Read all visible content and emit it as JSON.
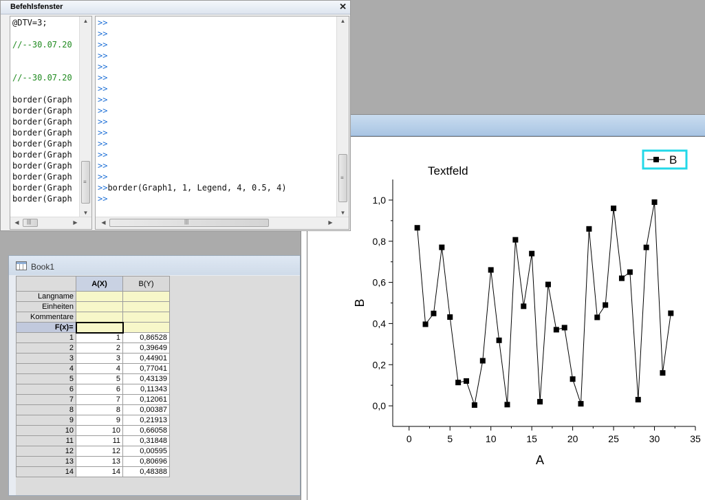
{
  "command_window": {
    "title": "Befehlsfenster",
    "close_glyph": "✕",
    "history_lines": [
      {
        "text": "@DTV=3;",
        "kind": "code"
      },
      {
        "text": "",
        "kind": "code"
      },
      {
        "text": "//--30.07.20",
        "kind": "comment"
      },
      {
        "text": "",
        "kind": "code"
      },
      {
        "text": "",
        "kind": "code"
      },
      {
        "text": "//--30.07.20",
        "kind": "comment"
      },
      {
        "text": "",
        "kind": "code"
      },
      {
        "text": "border(Graph",
        "kind": "code"
      },
      {
        "text": "border(Graph",
        "kind": "code"
      },
      {
        "text": "border(Graph",
        "kind": "code"
      },
      {
        "text": "border(Graph",
        "kind": "code"
      },
      {
        "text": "border(Graph",
        "kind": "code"
      },
      {
        "text": "border(Graph",
        "kind": "code"
      },
      {
        "text": "border(Graph",
        "kind": "code"
      },
      {
        "text": "border(Graph",
        "kind": "code"
      },
      {
        "text": "border(Graph",
        "kind": "code"
      },
      {
        "text": "border(Graph",
        "kind": "code"
      }
    ],
    "prompt": ">>",
    "console_lines": [
      "",
      "",
      "",
      "",
      "",
      "",
      "",
      "",
      "",
      "",
      "",
      "",
      "",
      "",
      "",
      "border(Graph1, 1, Legend, 4, 0.5, 4)",
      ""
    ]
  },
  "book": {
    "title": "Book1",
    "columns": [
      "A(X)",
      "B(Y)"
    ],
    "meta_rows": [
      "Langname",
      "Einheiten",
      "Kommentare",
      "F(x)="
    ],
    "rows": [
      {
        "n": "1",
        "a": "1",
        "b": "0,86528"
      },
      {
        "n": "2",
        "a": "2",
        "b": "0,39649"
      },
      {
        "n": "3",
        "a": "3",
        "b": "0,44901"
      },
      {
        "n": "4",
        "a": "4",
        "b": "0,77041"
      },
      {
        "n": "5",
        "a": "5",
        "b": "0,43139"
      },
      {
        "n": "6",
        "a": "6",
        "b": "0,11343"
      },
      {
        "n": "7",
        "a": "7",
        "b": "0,12061"
      },
      {
        "n": "8",
        "a": "8",
        "b": "0,00387"
      },
      {
        "n": "9",
        "a": "9",
        "b": "0,21913"
      },
      {
        "n": "10",
        "a": "10",
        "b": "0,66058"
      },
      {
        "n": "11",
        "a": "11",
        "b": "0,31848"
      },
      {
        "n": "12",
        "a": "12",
        "b": "0,00595"
      },
      {
        "n": "13",
        "a": "13",
        "b": "0,80696"
      },
      {
        "n": "14",
        "a": "14",
        "b": "0,48388"
      }
    ]
  },
  "chart_data": {
    "type": "line",
    "title": "Textfeld",
    "xlabel": "A",
    "ylabel": "B",
    "xlim": [
      -2,
      35
    ],
    "ylim": [
      -0.1,
      1.1
    ],
    "xticks": [
      "0",
      "5",
      "10",
      "15",
      "20",
      "25",
      "30",
      "35"
    ],
    "yticks": [
      "0,0",
      "0,2",
      "0,4",
      "0,6",
      "0,8",
      "1,0"
    ],
    "legend_label": "B",
    "legend_position": "top-right",
    "legend_border_color": "#23d8e8",
    "marker": "square",
    "line_color": "#000000",
    "x": [
      1,
      2,
      3,
      4,
      5,
      6,
      7,
      8,
      9,
      10,
      11,
      12,
      13,
      14,
      15,
      16,
      17,
      18,
      19,
      20,
      21,
      22,
      23,
      24,
      25,
      26,
      27,
      28,
      29,
      30,
      31,
      32
    ],
    "y": [
      0.86528,
      0.39649,
      0.44901,
      0.77041,
      0.43139,
      0.11343,
      0.12061,
      0.00387,
      0.21913,
      0.66058,
      0.31848,
      0.00595,
      0.80696,
      0.48388,
      0.74,
      0.02,
      0.59,
      0.37,
      0.38,
      0.13,
      0.01,
      0.86,
      0.43,
      0.49,
      0.96,
      0.62,
      0.65,
      0.03,
      0.77,
      0.99,
      0.16,
      0.45
    ]
  }
}
